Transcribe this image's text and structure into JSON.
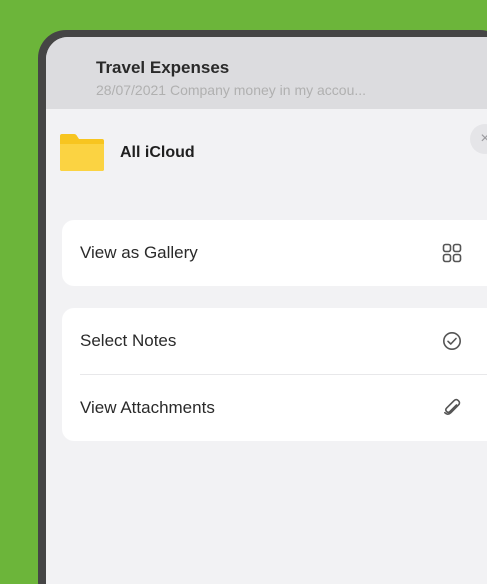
{
  "note": {
    "title": "Travel Expenses",
    "subtitle": "28/07/2021  Company money in my accou..."
  },
  "folder": {
    "label": "All iCloud",
    "icon": "folder-icon",
    "color": "#f7c520"
  },
  "close_icon": "×",
  "menu": {
    "group1": [
      {
        "label": "View as Gallery",
        "icon": "gallery-grid-icon"
      }
    ],
    "group2": [
      {
        "label": "Select Notes",
        "icon": "checkmark-circle-icon"
      },
      {
        "label": "View Attachments",
        "icon": "paperclip-icon"
      }
    ]
  },
  "colors": {
    "background": "#6cb53a",
    "device_bezel": "#454545",
    "sheet": "#f2f2f4",
    "menu_card": "#ffffff"
  }
}
